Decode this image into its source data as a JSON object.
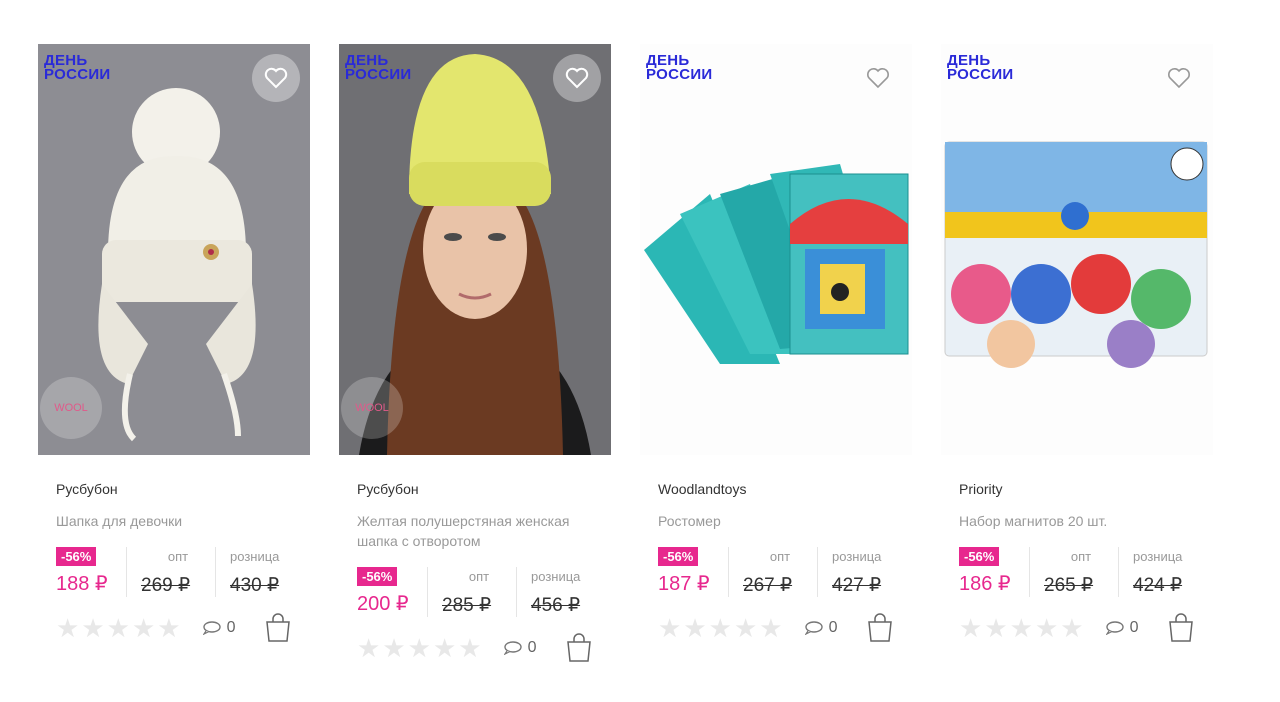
{
  "labels": {
    "opt": "опт",
    "retail": "розница",
    "promo_line1": "ДЕНЬ",
    "promo_line2": "РОССИИ",
    "wool": "WOOL"
  },
  "colors": {
    "accent": "#e7288e",
    "promo": "#2a2ad8"
  },
  "products": [
    {
      "brand": "Русбубон",
      "name": "Шапка для девочки",
      "discount": "-56%",
      "price": "188 ₽",
      "opt_price": "269 ₽",
      "retail_price": "430 ₽",
      "comments": "0",
      "rating": 0,
      "image": "white-knit-hat",
      "wool_badge": true
    },
    {
      "brand": "Русбубон",
      "name": "Желтая полушерстяная женская шапка с отворотом",
      "discount": "-56%",
      "price": "200 ₽",
      "opt_price": "285 ₽",
      "retail_price": "456 ₽",
      "comments": "0",
      "rating": 0,
      "image": "yellow-beanie-model",
      "wool_badge": true
    },
    {
      "brand": "Woodlandtoys",
      "name": "Ростомер",
      "discount": "-56%",
      "price": "187 ₽",
      "opt_price": "267 ₽",
      "retail_price": "427 ₽",
      "comments": "0",
      "rating": 0,
      "image": "height-chart-puzzle",
      "wool_badge": false
    },
    {
      "brand": "Priority",
      "name": "Набор магнитов 20 шт.",
      "discount": "-56%",
      "price": "186 ₽",
      "opt_price": "265 ₽",
      "retail_price": "424 ₽",
      "comments": "0",
      "rating": 0,
      "image": "magnet-set",
      "wool_badge": false
    }
  ]
}
